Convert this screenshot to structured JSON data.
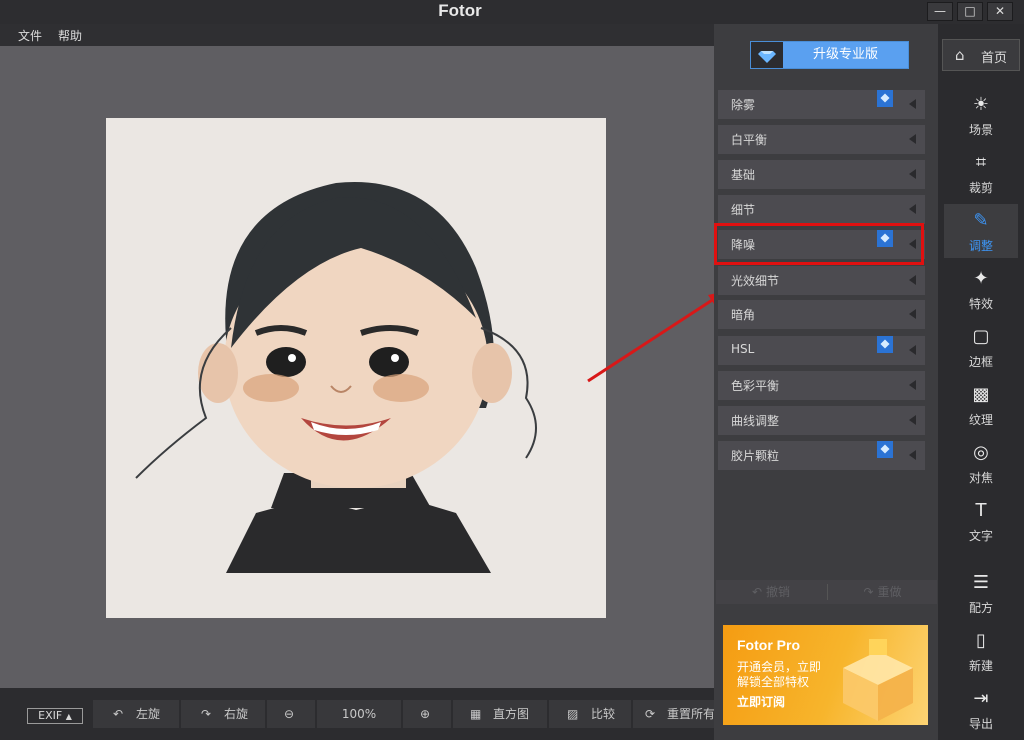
{
  "app": {
    "title": "Fotor"
  },
  "window_controls": {
    "minimize": "—",
    "maximize": "□",
    "close": "✕"
  },
  "menu": {
    "file": "文件",
    "help": "帮助"
  },
  "upgrade": {
    "label": "升级专业版"
  },
  "home": {
    "label": "首页"
  },
  "adjust_items": [
    {
      "label": "除雾",
      "pro": true
    },
    {
      "label": "白平衡",
      "pro": false
    },
    {
      "label": "基础",
      "pro": false
    },
    {
      "label": "细节",
      "pro": false
    },
    {
      "label": "降噪",
      "pro": true
    },
    {
      "label": "光效细节",
      "pro": false
    },
    {
      "label": "暗角",
      "pro": false
    },
    {
      "label": "HSL",
      "pro": true
    },
    {
      "label": "色彩平衡",
      "pro": false
    },
    {
      "label": "曲线调整",
      "pro": false
    },
    {
      "label": "胶片颗粒",
      "pro": true
    }
  ],
  "history": {
    "undo": "撤销",
    "redo": "重做"
  },
  "promo": {
    "title": "Fotor Pro",
    "line1": "开通会员，立即",
    "line2": "解锁全部特权",
    "cta": "立即订阅"
  },
  "tools": [
    {
      "label": "场景",
      "icon": "sun-icon"
    },
    {
      "label": "裁剪",
      "icon": "crop-icon"
    },
    {
      "label": "调整",
      "icon": "pencil-icon",
      "active": true
    },
    {
      "label": "特效",
      "icon": "sparkle-icon"
    },
    {
      "label": "边框",
      "icon": "frame-icon"
    },
    {
      "label": "纹理",
      "icon": "texture-icon"
    },
    {
      "label": "对焦",
      "icon": "focus-icon"
    },
    {
      "label": "文字",
      "icon": "text-icon"
    },
    {
      "label": "配方",
      "icon": "clipboard-icon"
    },
    {
      "label": "新建",
      "icon": "new-file-icon"
    },
    {
      "label": "导出",
      "icon": "export-icon"
    }
  ],
  "bottom": {
    "exif": "EXIF",
    "rotate_left": "左旋",
    "rotate_right": "右旋",
    "zoom": "100%",
    "histogram": "直方图",
    "compare": "比较",
    "reset": "重置所有"
  },
  "colors": {
    "accent": "#3d95f5",
    "upgrade_bg": "#5aa0f0",
    "highlight": "#e01010",
    "pro_badge": "#2b73d4"
  }
}
